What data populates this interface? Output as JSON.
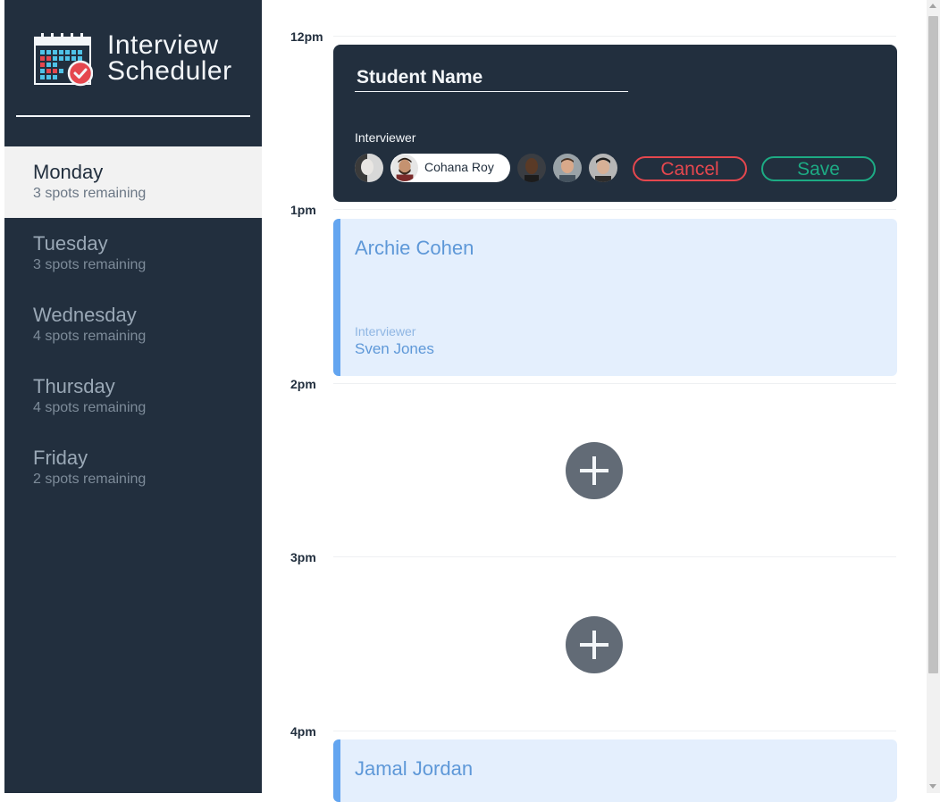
{
  "app": {
    "title_line1": "Interview",
    "title_line2": "Scheduler",
    "logo_icon": "calendar-check-icon"
  },
  "sidebar": {
    "days": [
      {
        "name": "Monday",
        "spots": "3 spots remaining",
        "selected": true
      },
      {
        "name": "Tuesday",
        "spots": "3 spots remaining"
      },
      {
        "name": "Wednesday",
        "spots": "4 spots remaining"
      },
      {
        "name": "Thursday",
        "spots": "4 spots remaining"
      },
      {
        "name": "Friday",
        "spots": "2 spots remaining"
      }
    ]
  },
  "schedule": {
    "hours": [
      "12pm",
      "1pm",
      "2pm",
      "3pm",
      "4pm"
    ],
    "form": {
      "student_placeholder": "Student Name",
      "interviewer_label": "Interviewer",
      "selected_interviewer": "Cohana Roy",
      "cancel_label": "Cancel",
      "save_label": "Save"
    },
    "appointments": [
      {
        "student": "Archie Cohen",
        "interviewer_label": "Interviewer",
        "interviewer": "Sven Jones"
      },
      {
        "student": "Jamal Jordan"
      }
    ],
    "add_icon": "plus-icon"
  },
  "colors": {
    "sidebar_bg": "#222f3e",
    "selected_day_bg": "#f2f2f2",
    "booked_bg": "#e4effd",
    "booked_accent": "#63a5f0",
    "cancel": "#e5474e",
    "save": "#1dab84",
    "add_button": "#626b76"
  }
}
